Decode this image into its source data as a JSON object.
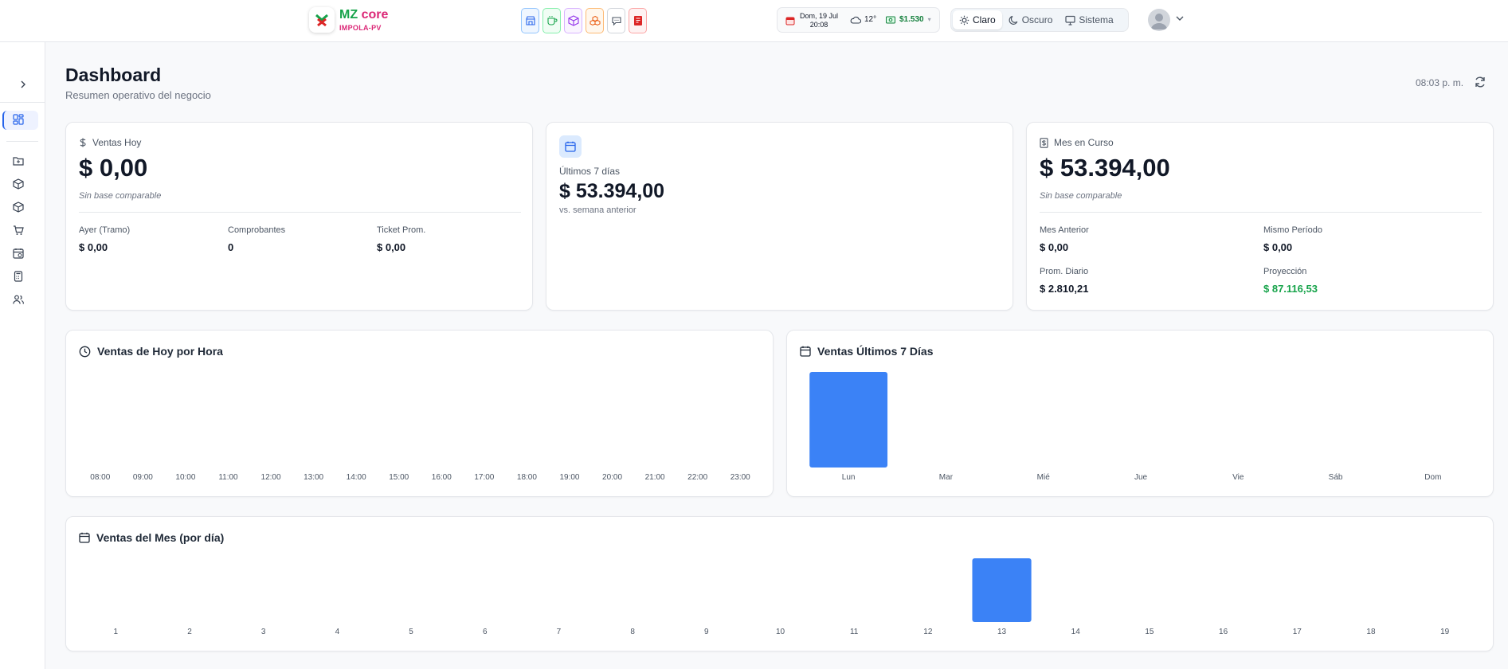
{
  "brand": {
    "name_a": "MZ",
    "name_b": "core",
    "subtitle": "IMPOLA-PV"
  },
  "quick_apps": [
    {
      "icon": "store-icon",
      "border": "#93c5fd",
      "bg": "#eff6ff",
      "color": "#2563eb"
    },
    {
      "icon": "coffee-icon",
      "border": "#86efac",
      "bg": "#f0fdf4",
      "color": "#16a34a"
    },
    {
      "icon": "box-icon",
      "border": "#d8b4fe",
      "bg": "#faf5ff",
      "color": "#9333ea"
    },
    {
      "icon": "boxes-icon",
      "border": "#fdba74",
      "bg": "#fff7ed",
      "color": "#ea580c"
    },
    {
      "icon": "chat-icon",
      "border": "#d1d5db",
      "bg": "#ffffff",
      "color": "#4b5563"
    },
    {
      "icon": "receipt-icon",
      "border": "#fca5a5",
      "bg": "#fef2f2",
      "color": "#dc2626"
    }
  ],
  "status": {
    "date_line1": "Dom, 19 Jul",
    "date_line2": "20:08",
    "temperature": "12°",
    "exchange": "$1.530"
  },
  "theme": {
    "claro": "Claro",
    "oscuro": "Oscuro",
    "sistema": "Sistema",
    "selected": "Claro"
  },
  "header": {
    "title": "Dashboard",
    "subtitle": "Resumen operativo del negocio",
    "time": "08:03 p. m."
  },
  "kpi_today": {
    "label": "Ventas Hoy",
    "value": "$ 0,00",
    "note": "Sin base comparable",
    "stats": [
      {
        "label": "Ayer (Tramo)",
        "value": "$ 0,00"
      },
      {
        "label": "Comprobantes",
        "value": "0"
      },
      {
        "label": "Ticket Prom.",
        "value": "$ 0,00"
      }
    ]
  },
  "kpi_week": {
    "label": "Últimos 7 días",
    "value": "$ 53.394,00",
    "note": "vs. semana anterior"
  },
  "kpi_month": {
    "label": "Mes en Curso",
    "value": "$ 53.394,00",
    "note": "Sin base comparable",
    "stats": [
      {
        "label": "Mes Anterior",
        "value": "$ 0,00"
      },
      {
        "label": "Mismo Período",
        "value": "$ 0,00"
      },
      {
        "label": "Prom. Diario",
        "value": "$ 2.810,21"
      },
      {
        "label": "Proyección",
        "value": "$ 87.116,53"
      }
    ]
  },
  "chart_titles": {
    "hourly": "Ventas de Hoy por Hora",
    "weekly": "Ventas Últimos 7 Días",
    "monthly": "Ventas del Mes (por día)"
  },
  "colors": {
    "bar": "#3b82f6",
    "accent": "#2563eb",
    "positive": "#16a34a"
  },
  "chart_data": [
    {
      "type": "bar",
      "title": "Ventas de Hoy por Hora",
      "categories": [
        "08:00",
        "09:00",
        "10:00",
        "11:00",
        "12:00",
        "13:00",
        "14:00",
        "15:00",
        "16:00",
        "17:00",
        "18:00",
        "19:00",
        "20:00",
        "21:00",
        "22:00",
        "23:00"
      ],
      "values": [
        0,
        0,
        0,
        0,
        0,
        0,
        0,
        0,
        0,
        0,
        0,
        0,
        0,
        0,
        0,
        0
      ]
    },
    {
      "type": "bar",
      "title": "Ventas Últimos 7 Días",
      "categories": [
        "Lun",
        "Mar",
        "Mié",
        "Jue",
        "Vie",
        "Sáb",
        "Dom"
      ],
      "values": [
        53394,
        0,
        0,
        0,
        0,
        0,
        0
      ]
    },
    {
      "type": "bar",
      "title": "Ventas del Mes (por día)",
      "categories": [
        "1",
        "2",
        "3",
        "4",
        "5",
        "6",
        "7",
        "8",
        "9",
        "10",
        "11",
        "12",
        "13",
        "14",
        "15",
        "16",
        "17",
        "18",
        "19"
      ],
      "values": [
        0,
        0,
        0,
        0,
        0,
        0,
        0,
        0,
        0,
        0,
        0,
        0,
        53394,
        0,
        0,
        0,
        0,
        0,
        0
      ]
    }
  ]
}
